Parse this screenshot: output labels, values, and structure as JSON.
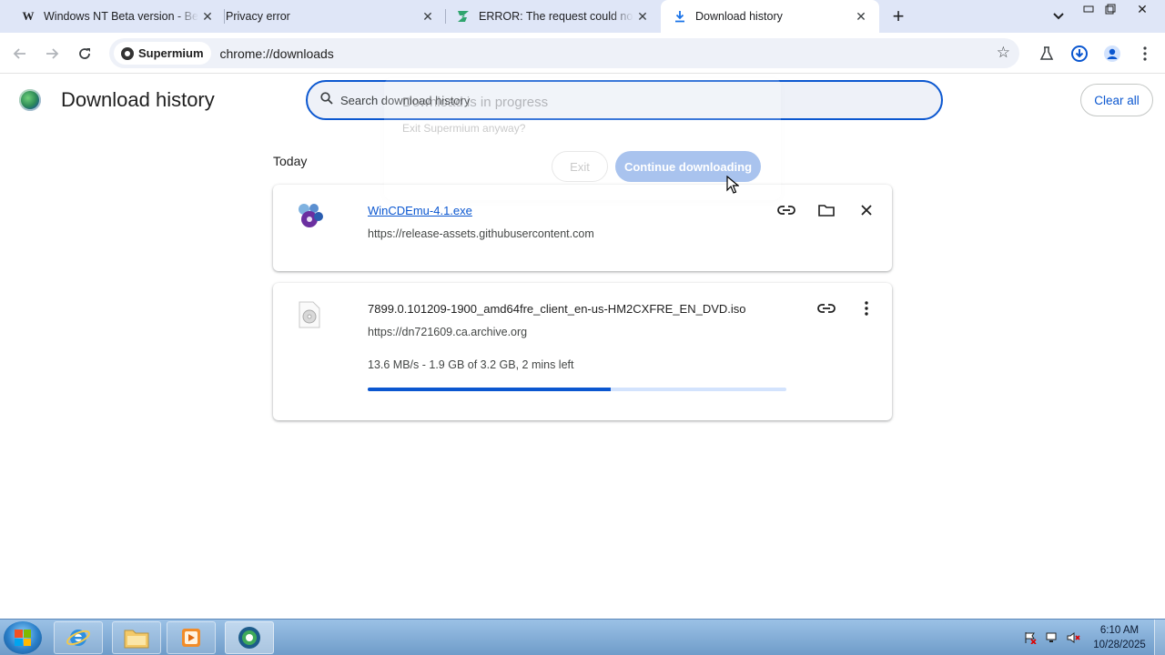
{
  "tabs": [
    {
      "title": "Windows NT Beta version - Beta",
      "favicon": "W"
    },
    {
      "title": "Privacy error",
      "favicon": ""
    },
    {
      "title": "ERROR: The request could not be satisfied",
      "favicon": "Z"
    },
    {
      "title": "Download history",
      "favicon": "download-icon"
    }
  ],
  "toolbar": {
    "browser_chip": "Supermium",
    "url": "chrome://downloads"
  },
  "page": {
    "title": "Download history",
    "search_placeholder": "Search download history",
    "clear_all": "Clear all",
    "section": "Today"
  },
  "downloads": [
    {
      "name": "WinCDEmu-4.1.exe",
      "url": "https://release-assets.githubusercontent.com"
    },
    {
      "name": "7899.0.101209-1900_amd64fre_client_en-us-HM2CXFRE_EN_DVD.iso",
      "url": "https://dn721609.ca.archive.org",
      "status": "13.6 MB/s - 1.9 GB of 3.2 GB, 2 mins left",
      "progress": 0.58
    }
  ],
  "dialog": {
    "title": "Download is in progress",
    "body": "Exit Supermium anyway?",
    "exit": "Exit",
    "continue": "Continue downloading"
  },
  "taskbar": {
    "time": "6:10 AM",
    "date": "10/28/2025"
  },
  "colors": {
    "accent": "#0b57d0",
    "tabstrip": "#dfe6f7"
  }
}
